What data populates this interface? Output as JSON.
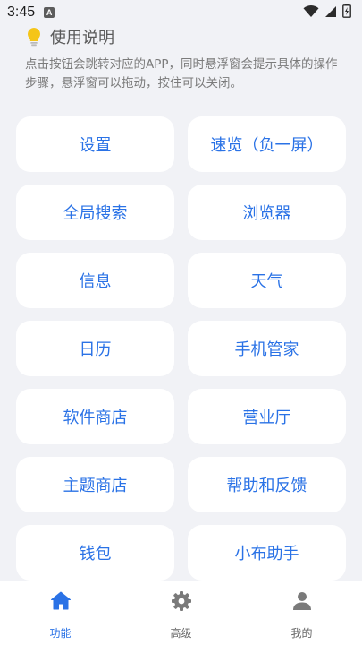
{
  "status_bar": {
    "time": "3:45",
    "notification_icon": "A",
    "icons": [
      "wifi-icon",
      "signal-icon",
      "battery-icon"
    ]
  },
  "instructions": {
    "icon": "lightbulb-icon",
    "title": "使用说明",
    "description": "点击按钮会跳转对应的APP，同时悬浮窗会提示具体的操作步骤，悬浮窗可以拖动，按住可以关闭。"
  },
  "buttons": [
    {
      "label": "设置"
    },
    {
      "label": "速览（负一屏）"
    },
    {
      "label": "全局搜索"
    },
    {
      "label": "浏览器"
    },
    {
      "label": "信息"
    },
    {
      "label": "天气"
    },
    {
      "label": "日历"
    },
    {
      "label": "手机管家"
    },
    {
      "label": "软件商店"
    },
    {
      "label": "营业厅"
    },
    {
      "label": "主题商店"
    },
    {
      "label": "帮助和反馈"
    },
    {
      "label": "钱包"
    },
    {
      "label": "小布助手"
    }
  ],
  "bottom_nav": {
    "items": [
      {
        "label": "功能",
        "icon": "home-icon",
        "active": true
      },
      {
        "label": "高级",
        "icon": "gear-icon",
        "active": false
      },
      {
        "label": "我的",
        "icon": "person-icon",
        "active": false
      }
    ]
  },
  "colors": {
    "accent": "#2a72e6",
    "background": "#f1f2f6",
    "card": "#ffffff",
    "bulb": "#f5c518",
    "inactive_icon": "#7a7a7a"
  }
}
